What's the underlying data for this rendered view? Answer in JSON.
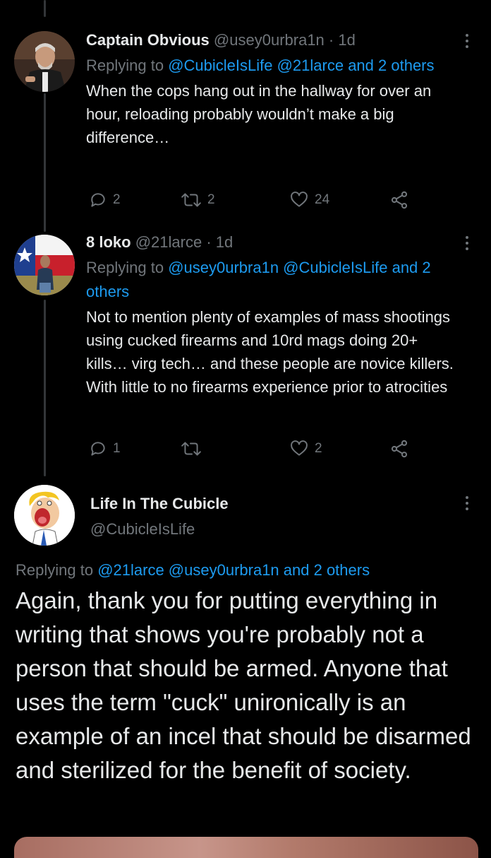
{
  "thread": [
    {
      "name": "Captain Obvious",
      "handle": "@usey0urbra1n",
      "time": "· 1d",
      "replying_prefix": "Replying to",
      "replying_links": "@CubicleIsLife @21larce and 2 others",
      "text": "When the cops hang out in the hallway for over an hour, reloading probably wouldn’t make a big difference…",
      "replies": "2",
      "retweets": "2",
      "likes": "24"
    },
    {
      "name": "8 loko",
      "handle": "@21larce",
      "time": "· 1d",
      "replying_prefix": "Replying to",
      "replying_links": "@usey0urbra1n @CubicleIsLife and 2 others",
      "text": "Not to mention plenty of examples of mass shootings using cucked firearms and 10rd mags doing 20+ kills… virg tech… and these people are novice killers. With little to no firearms experience prior to atrocities",
      "replies": "1",
      "retweets": "",
      "likes": "2"
    }
  ],
  "main": {
    "name": "Life In The Cubicle",
    "handle": "@CubicleIsLife",
    "replying_prefix": "Replying to",
    "replying_links": "@21larce @usey0urbra1n and 2 others",
    "text": "Again, thank you for putting everything in writing that shows you're probably not a person that should be armed. Anyone that uses the term \"cuck\" unironically is an example of an incel that should be disarmed and sterilized for the benefit of society."
  },
  "icons": {
    "reply": "reply-icon",
    "retweet": "retweet-icon",
    "like": "heart-icon",
    "share": "share-icon",
    "more": "more-options-icon"
  },
  "colors": {
    "background": "#000000",
    "text": "#e7e9ea",
    "muted": "#71767b",
    "link": "#1d9bf0"
  }
}
